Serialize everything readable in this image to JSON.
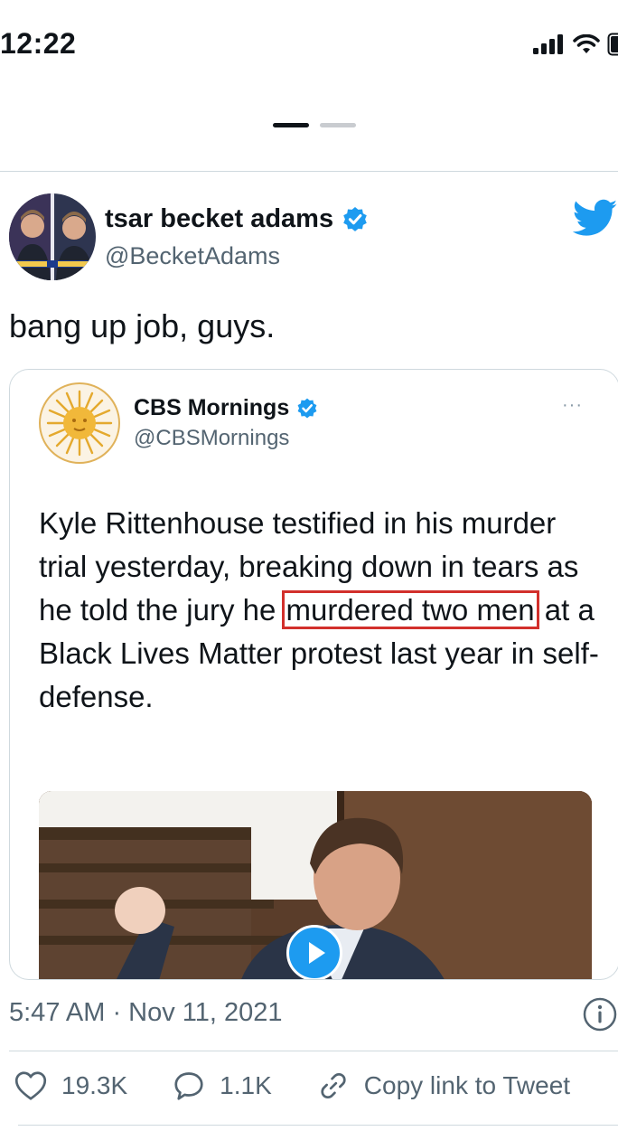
{
  "status_bar": {
    "time": "12:22"
  },
  "author": {
    "name": "tsar becket adams",
    "handle": "@BecketAdams"
  },
  "tweet": {
    "text": "bang up job, guys.",
    "timestamp": "5:47 AM · Nov 11, 2021"
  },
  "quoted_tweet": {
    "name": "CBS Mornings",
    "handle": "@CBSMornings",
    "more": "···",
    "text_before": "Kyle Rittenhouse testified in his murder trial yesterday, breaking down in tears as he told the jury he ",
    "text_highlight": "murdered two men",
    "text_after": " at a Black Lives Matter protest last year in self-defense."
  },
  "actions": {
    "likes": "19.3K",
    "replies": "1.1K",
    "copy_link": "Copy link to Tweet"
  },
  "colors": {
    "accent": "#1d9bf0",
    "highlight_box": "#d2302c",
    "secondary_text": "#536471"
  },
  "icons": [
    "signal-icon",
    "wifi-icon",
    "verified-badge-icon",
    "twitter-bird-icon",
    "play-icon",
    "info-icon",
    "heart-icon",
    "reply-icon",
    "link-icon"
  ]
}
